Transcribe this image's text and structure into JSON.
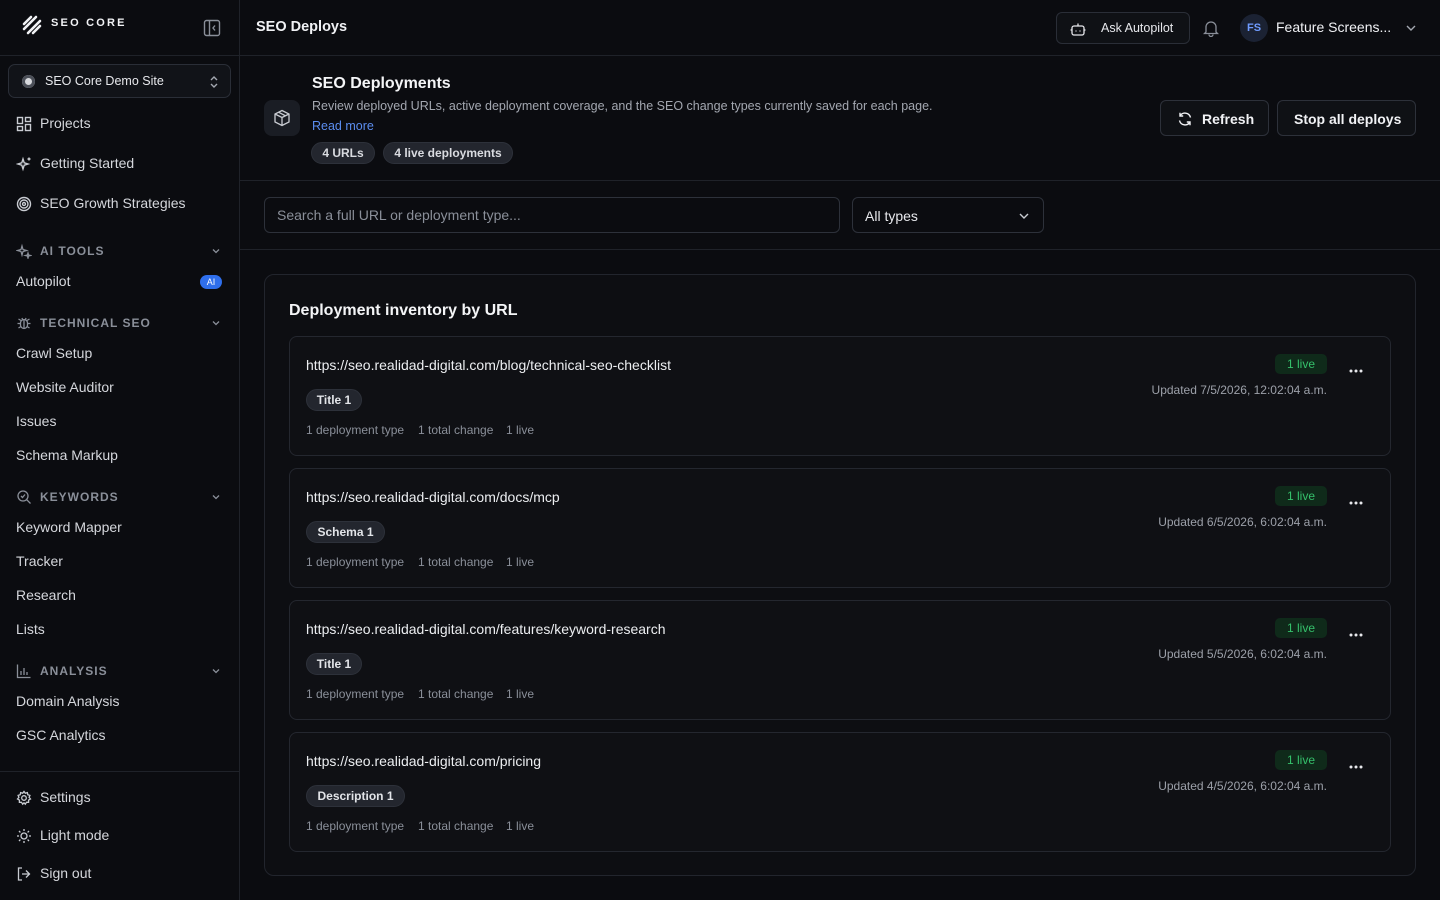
{
  "brand": {
    "name": "SEO CORE"
  },
  "site_selector": {
    "value": "SEO Core Demo Site"
  },
  "sidebar": {
    "main": [
      {
        "label": "Projects",
        "icon": "grid-icon"
      },
      {
        "label": "Getting Started",
        "icon": "sparkle-icon"
      },
      {
        "label": "SEO Growth Strategies",
        "icon": "target-icon"
      }
    ],
    "sections": [
      {
        "title": "AI TOOLS",
        "icon": "sparkles-icon",
        "items": [
          {
            "label": "Autopilot",
            "badge": "AI"
          }
        ]
      },
      {
        "title": "TECHNICAL SEO",
        "icon": "bug-icon",
        "items": [
          {
            "label": "Crawl Setup"
          },
          {
            "label": "Website Auditor"
          },
          {
            "label": "Issues"
          },
          {
            "label": "Schema Markup"
          }
        ]
      },
      {
        "title": "KEYWORDS",
        "icon": "search-icon",
        "items": [
          {
            "label": "Keyword Mapper"
          },
          {
            "label": "Tracker"
          },
          {
            "label": "Research"
          },
          {
            "label": "Lists"
          }
        ]
      },
      {
        "title": "ANALYSIS",
        "icon": "bar-chart-icon",
        "items": [
          {
            "label": "Domain Analysis"
          },
          {
            "label": "GSC Analytics"
          }
        ]
      }
    ],
    "footer": [
      {
        "label": "Settings",
        "icon": "gear-icon"
      },
      {
        "label": "Light mode",
        "icon": "sun-icon"
      },
      {
        "label": "Sign out",
        "icon": "sign-out-icon"
      }
    ]
  },
  "topbar": {
    "title": "SEO Deploys",
    "ask_label": "Ask Autopilot",
    "user_initials": "FS",
    "user_name": "Feature Screens..."
  },
  "header": {
    "title": "SEO Deployments",
    "description": "Review deployed URLs, active deployment coverage, and the SEO change types currently saved for each page.",
    "read_more": "Read more",
    "pills": [
      "4 URLs",
      "4 live deployments"
    ],
    "refresh_label": "Refresh",
    "stop_label": "Stop all deploys"
  },
  "filters": {
    "search_placeholder": "Search a full URL or deployment type...",
    "type_value": "All types"
  },
  "inventory": {
    "title": "Deployment inventory by URL",
    "rows": [
      {
        "url": "https://seo.realidad-digital.com/blog/technical-seo-checklist",
        "tag": "Title 1",
        "types": "1 deployment type",
        "changes": "1 total change",
        "live_meta": "1 live",
        "live_badge": "1 live",
        "updated": "Updated 7/5/2026, 12:02:04 a.m."
      },
      {
        "url": "https://seo.realidad-digital.com/docs/mcp",
        "tag": "Schema 1",
        "types": "1 deployment type",
        "changes": "1 total change",
        "live_meta": "1 live",
        "live_badge": "1 live",
        "updated": "Updated 6/5/2026, 6:02:04 a.m."
      },
      {
        "url": "https://seo.realidad-digital.com/features/keyword-research",
        "tag": "Title 1",
        "types": "1 deployment type",
        "changes": "1 total change",
        "live_meta": "1 live",
        "live_badge": "1 live",
        "updated": "Updated 5/5/2026, 6:02:04 a.m."
      },
      {
        "url": "https://seo.realidad-digital.com/pricing",
        "tag": "Description 1",
        "types": "1 deployment type",
        "changes": "1 total change",
        "live_meta": "1 live",
        "live_badge": "1 live",
        "updated": "Updated 4/5/2026, 6:02:04 a.m."
      }
    ]
  },
  "colors": {
    "background": "#0b0c10",
    "accent": "#2f6fec",
    "link": "#5b8def",
    "live_green": "#35c06b"
  }
}
